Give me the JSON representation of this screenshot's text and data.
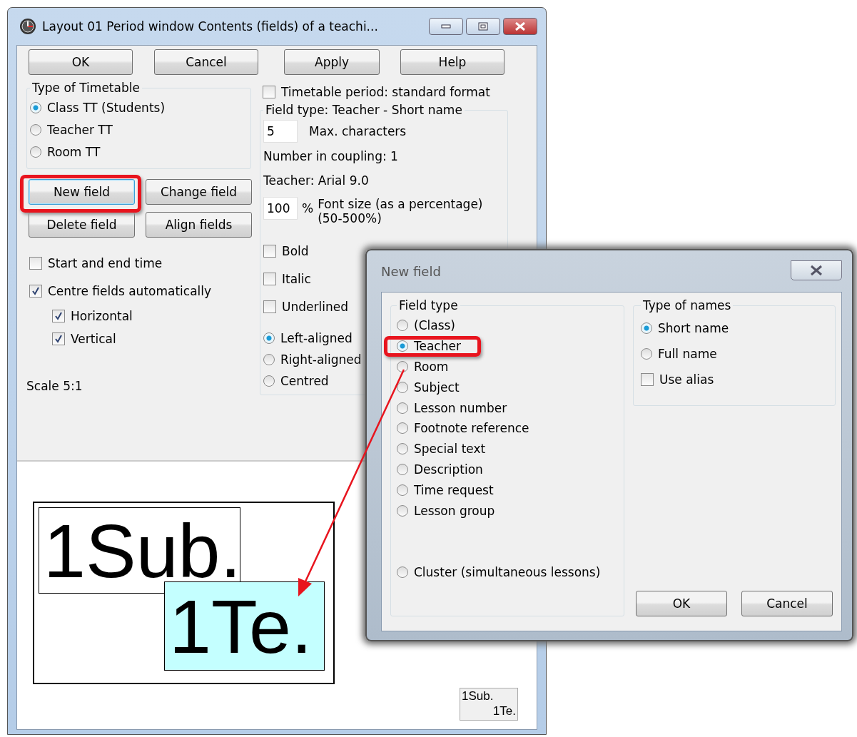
{
  "main_window": {
    "title": "Layout 01  Period window  Contents (fields) of a teachi...",
    "buttons": [
      "OK",
      "Cancel",
      "Apply",
      "Help"
    ],
    "timetable_type": {
      "legend": "Type of Timetable",
      "options": [
        {
          "label": "Class TT (Students)",
          "selected": true
        },
        {
          "label": "Teacher TT",
          "selected": false
        },
        {
          "label": "Room TT",
          "selected": false
        }
      ]
    },
    "field_buttons": [
      {
        "label": "New field",
        "focused": true
      },
      {
        "label": "Change field",
        "focused": false
      },
      {
        "label": "Delete field",
        "focused": false
      },
      {
        "label": "Align fields",
        "focused": false
      }
    ],
    "options": [
      {
        "label": "Start and end time",
        "checked": false
      },
      {
        "label": "Centre fields automatically",
        "checked": true,
        "children": [
          {
            "label": "Horizontal",
            "checked": true
          },
          {
            "label": "Vertical",
            "checked": true
          }
        ]
      }
    ],
    "scale": "Scale  5:1",
    "standard_format": {
      "label": "Timetable period: standard format",
      "checked": false
    },
    "field_group": {
      "legend": "Field type: Teacher - Short name",
      "max_chars": {
        "value": "5",
        "label": "Max. characters"
      },
      "coupling": "Number in coupling: 1",
      "font": "Teacher: Arial 9.0",
      "font_size": {
        "value": "100",
        "unit": "%",
        "label": "Font size (as a percentage) (50-500%)"
      },
      "styles": [
        {
          "label": "Bold",
          "checked": false
        },
        {
          "label": "Italic",
          "checked": false
        },
        {
          "label": "Underlined",
          "checked": false
        }
      ],
      "alignment": [
        {
          "label": "Left-aligned",
          "selected": true
        },
        {
          "label": "Right-aligned",
          "selected": false
        },
        {
          "label": "Centred",
          "selected": false
        }
      ]
    },
    "preview": {
      "fields": [
        {
          "text": "1Sub.",
          "highlighted": false
        },
        {
          "text": "1Te.",
          "highlighted": true
        }
      ],
      "thumbnail": [
        "1Sub.",
        "1Te."
      ]
    }
  },
  "dialog": {
    "title": "New field",
    "field_type": {
      "legend": "Field type",
      "options": [
        {
          "label": "(Class)",
          "selected": false
        },
        {
          "label": "Teacher",
          "selected": true
        },
        {
          "label": "Room",
          "selected": false
        },
        {
          "label": "Subject",
          "selected": false
        },
        {
          "label": "Lesson number",
          "selected": false
        },
        {
          "label": "Footnote reference",
          "selected": false
        },
        {
          "label": "Special text",
          "selected": false
        },
        {
          "label": "Description",
          "selected": false
        },
        {
          "label": "Time request",
          "selected": false
        },
        {
          "label": "Lesson group",
          "selected": false
        },
        {
          "label": "Cluster (simultaneous lessons)",
          "selected": false
        }
      ]
    },
    "names": {
      "legend": "Type of names",
      "options": [
        {
          "label": "Short name",
          "selected": true
        },
        {
          "label": "Full name",
          "selected": false
        }
      ],
      "use_alias": {
        "label": "Use alias",
        "checked": false
      }
    },
    "buttons": [
      "OK",
      "Cancel"
    ]
  }
}
